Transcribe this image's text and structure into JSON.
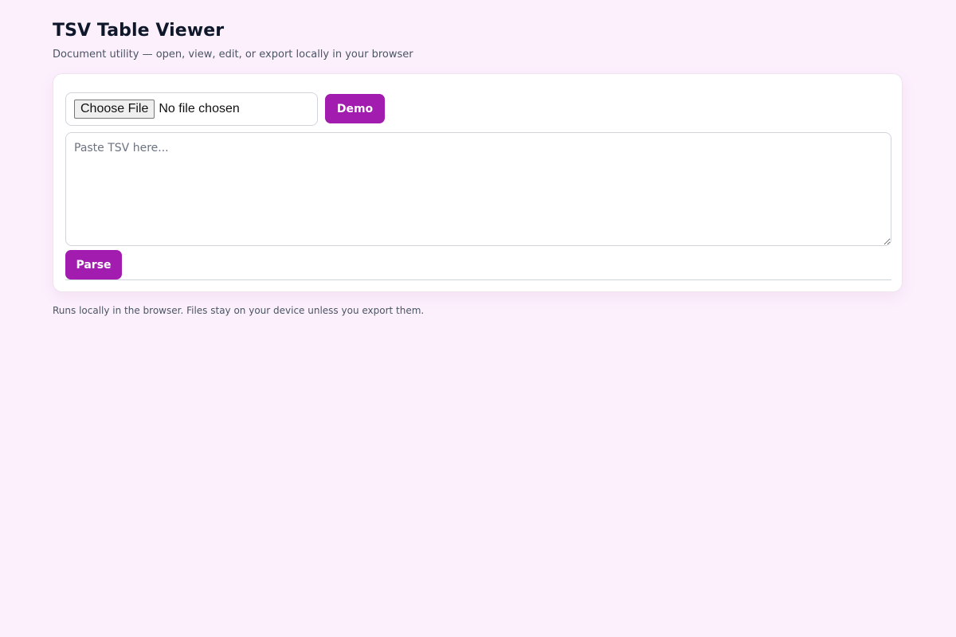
{
  "header": {
    "title": "TSV Table Viewer",
    "subtitle": "Document utility — open, view, edit, or export locally in your browser"
  },
  "file_input": {
    "button_label": "Choose File",
    "status": "No file chosen"
  },
  "actions": {
    "demo_label": "Demo",
    "parse_label": "Parse"
  },
  "tsv_input": {
    "value": "",
    "placeholder": "Paste TSV here..."
  },
  "footer": {
    "note": "Runs locally in the browser. Files stay on your device unless you export them."
  },
  "colors": {
    "accent": "#a21caf",
    "background": "#fdf0fd",
    "card": "#ffffff"
  }
}
